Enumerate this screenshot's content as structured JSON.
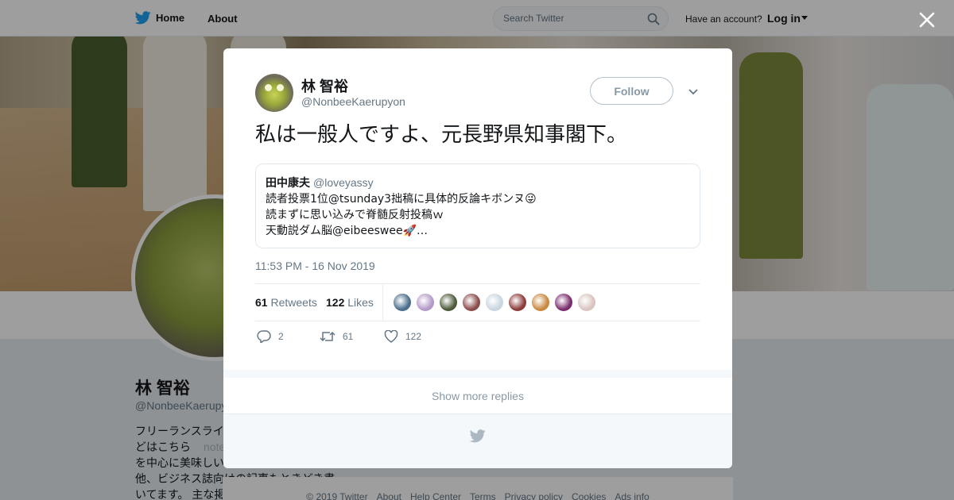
{
  "nav": {
    "home_label": "Home",
    "about_label": "About",
    "search_placeholder": "Search Twitter",
    "have_account": "Have an account?",
    "login_label": "Log in"
  },
  "profile": {
    "name": "林 智裕",
    "handle": "@NonbeeKaerupy",
    "bio_lines": [
      "フリーランスライ",
      "どはこちら",
      "を中心に美味しい",
      "他、ビジネス誌向けの記事もときどき書",
      "いてます。 主な掲"
    ],
    "bio_note": "note"
  },
  "footer": {
    "links": [
      "© 2019 Twitter",
      "About",
      "Help Center",
      "Terms",
      "Privacy policy",
      "Cookies",
      "Ads info"
    ]
  },
  "tweet": {
    "author_name": "林 智裕",
    "author_handle": "@NonbeeKaerupyon",
    "follow_label": "Follow",
    "text": "私は一般人ですよ、元長野県知事閣下。",
    "quote": {
      "name": "田中康夫",
      "handle": "@loveyassy",
      "line1": "読者投票1位@tsunday3拙稿に具体的反論キボンヌ😜",
      "line2": "読まずに思い込みで脊髄反射投稿ｗ",
      "line3": "天動説ダム脳@eibeeswee🚀…"
    },
    "timestamp": "11:53 PM - 16 Nov 2019",
    "retweets_count": "61",
    "retweets_label": "Retweets",
    "likes_count": "122",
    "likes_label": "Likes",
    "reply_count": "2",
    "retweet_action_count": "61",
    "like_action_count": "122",
    "face_colors": [
      "#4b6e8c",
      "#b49ac7",
      "#4c5a3a",
      "#8a4b4b",
      "#c9d6e0",
      "#8c3b3b",
      "#c9883f",
      "#7a2d6e",
      "#d9c4c0"
    ]
  },
  "replies": {
    "show_more_label": "Show more replies"
  },
  "colors": {
    "brand_blue": "#1da1f2",
    "overlay": "rgba(0,0,0,0.38)",
    "secondary_text": "#657786"
  },
  "icons": [
    "twitter-bird-icon",
    "search-icon",
    "close-icon",
    "chevron-down-icon",
    "reply-icon",
    "retweet-icon",
    "heart-icon"
  ]
}
